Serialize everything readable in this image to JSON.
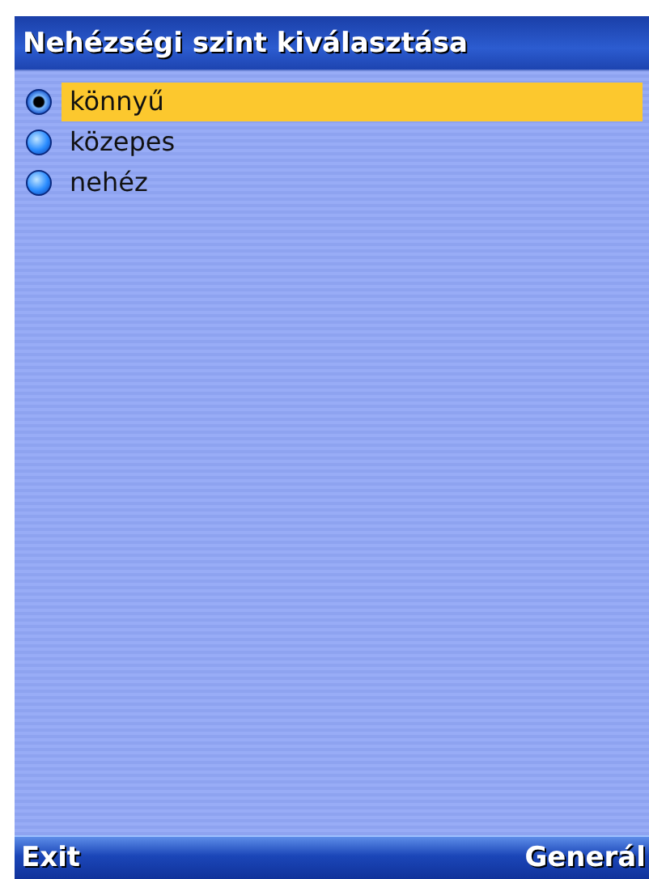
{
  "title": "Nehézségi szint kiválasztása",
  "options": [
    {
      "label": "könnyű",
      "checked": true,
      "selected": true
    },
    {
      "label": "közepes",
      "checked": false,
      "selected": false
    },
    {
      "label": "nehéz",
      "checked": false,
      "selected": false
    }
  ],
  "softkeys": {
    "left": "Exit",
    "right": "Generál"
  }
}
